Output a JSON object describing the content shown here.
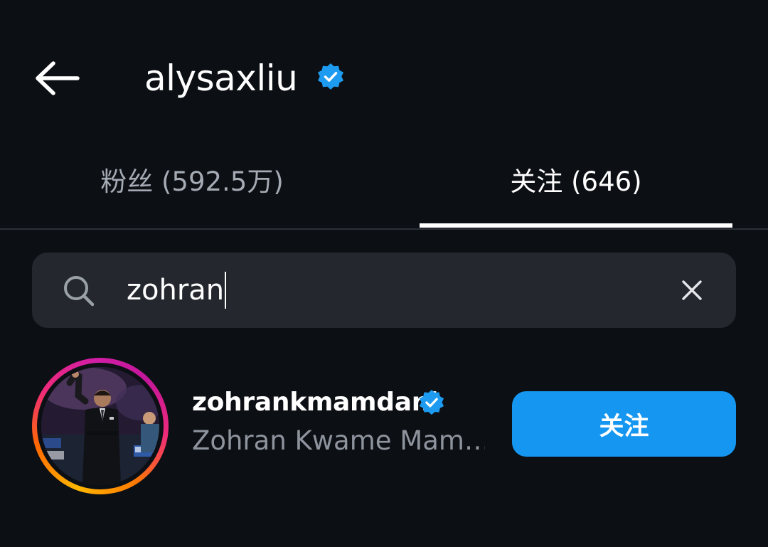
{
  "header": {
    "back_icon": "arrow-left-icon",
    "username": "alysaxliu",
    "verified_icon": "verified-badge-icon"
  },
  "tabs": [
    {
      "label": "粉丝 (592.5万)",
      "active": false
    },
    {
      "label": "关注 (646)",
      "active": true
    }
  ],
  "search": {
    "icon": "search-icon",
    "value": "zohran",
    "clear_icon": "close-icon"
  },
  "results": [
    {
      "username": "zohrankmamdani",
      "verified": true,
      "full_name": "Zohran Kwame Mam…",
      "button_label": "关注"
    }
  ],
  "colors": {
    "background": "#0c0f14",
    "search_bg": "#24282e",
    "accent_button": "#1596f0",
    "verified_badge": "#1d9bf0",
    "secondary_text": "#8e949d"
  }
}
